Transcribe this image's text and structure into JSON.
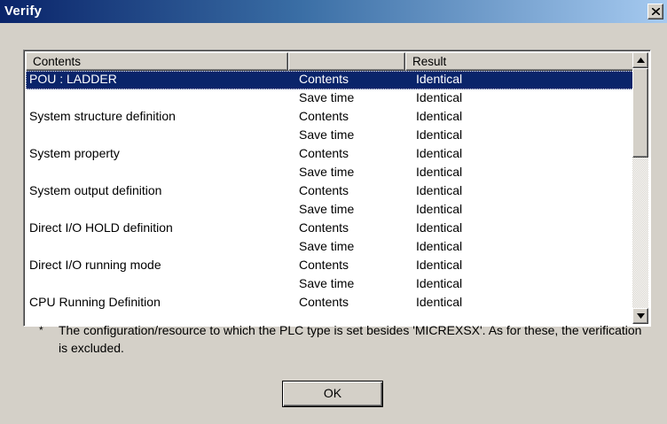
{
  "window": {
    "title": "Verify"
  },
  "list": {
    "headers": [
      "Contents",
      "",
      "Result"
    ],
    "rows": [
      [
        "POU : LADDER",
        "Contents",
        "Identical"
      ],
      [
        "",
        "Save time",
        "Identical"
      ],
      [
        "System structure definition",
        "Contents",
        "Identical"
      ],
      [
        "",
        "Save time",
        "Identical"
      ],
      [
        "System property",
        "Contents",
        "Identical"
      ],
      [
        "",
        "Save time",
        "Identical"
      ],
      [
        "System output definition",
        "Contents",
        "Identical"
      ],
      [
        "",
        "Save time",
        "Identical"
      ],
      [
        "Direct I/O HOLD definition",
        "Contents",
        "Identical"
      ],
      [
        "",
        "Save time",
        "Identical"
      ],
      [
        "Direct I/O running mode",
        "Contents",
        "Identical"
      ],
      [
        "",
        "Save time",
        "Identical"
      ],
      [
        "CPU Running Definition",
        "Contents",
        "Identical"
      ]
    ],
    "selected_index": 0
  },
  "note": {
    "mark": "*",
    "text": "The configuration/resource to which the PLC type is set besides 'MICREXSX'. As for these, the verification is excluded."
  },
  "buttons": {
    "ok": "OK"
  },
  "icons": {
    "close": "close-icon",
    "scroll_up": "arrow-up-icon",
    "scroll_down": "arrow-down-icon"
  },
  "colors": {
    "title_start": "#0a246a",
    "title_end": "#a6caf0",
    "selection": "#0a246a",
    "face": "#d4d0c8"
  }
}
